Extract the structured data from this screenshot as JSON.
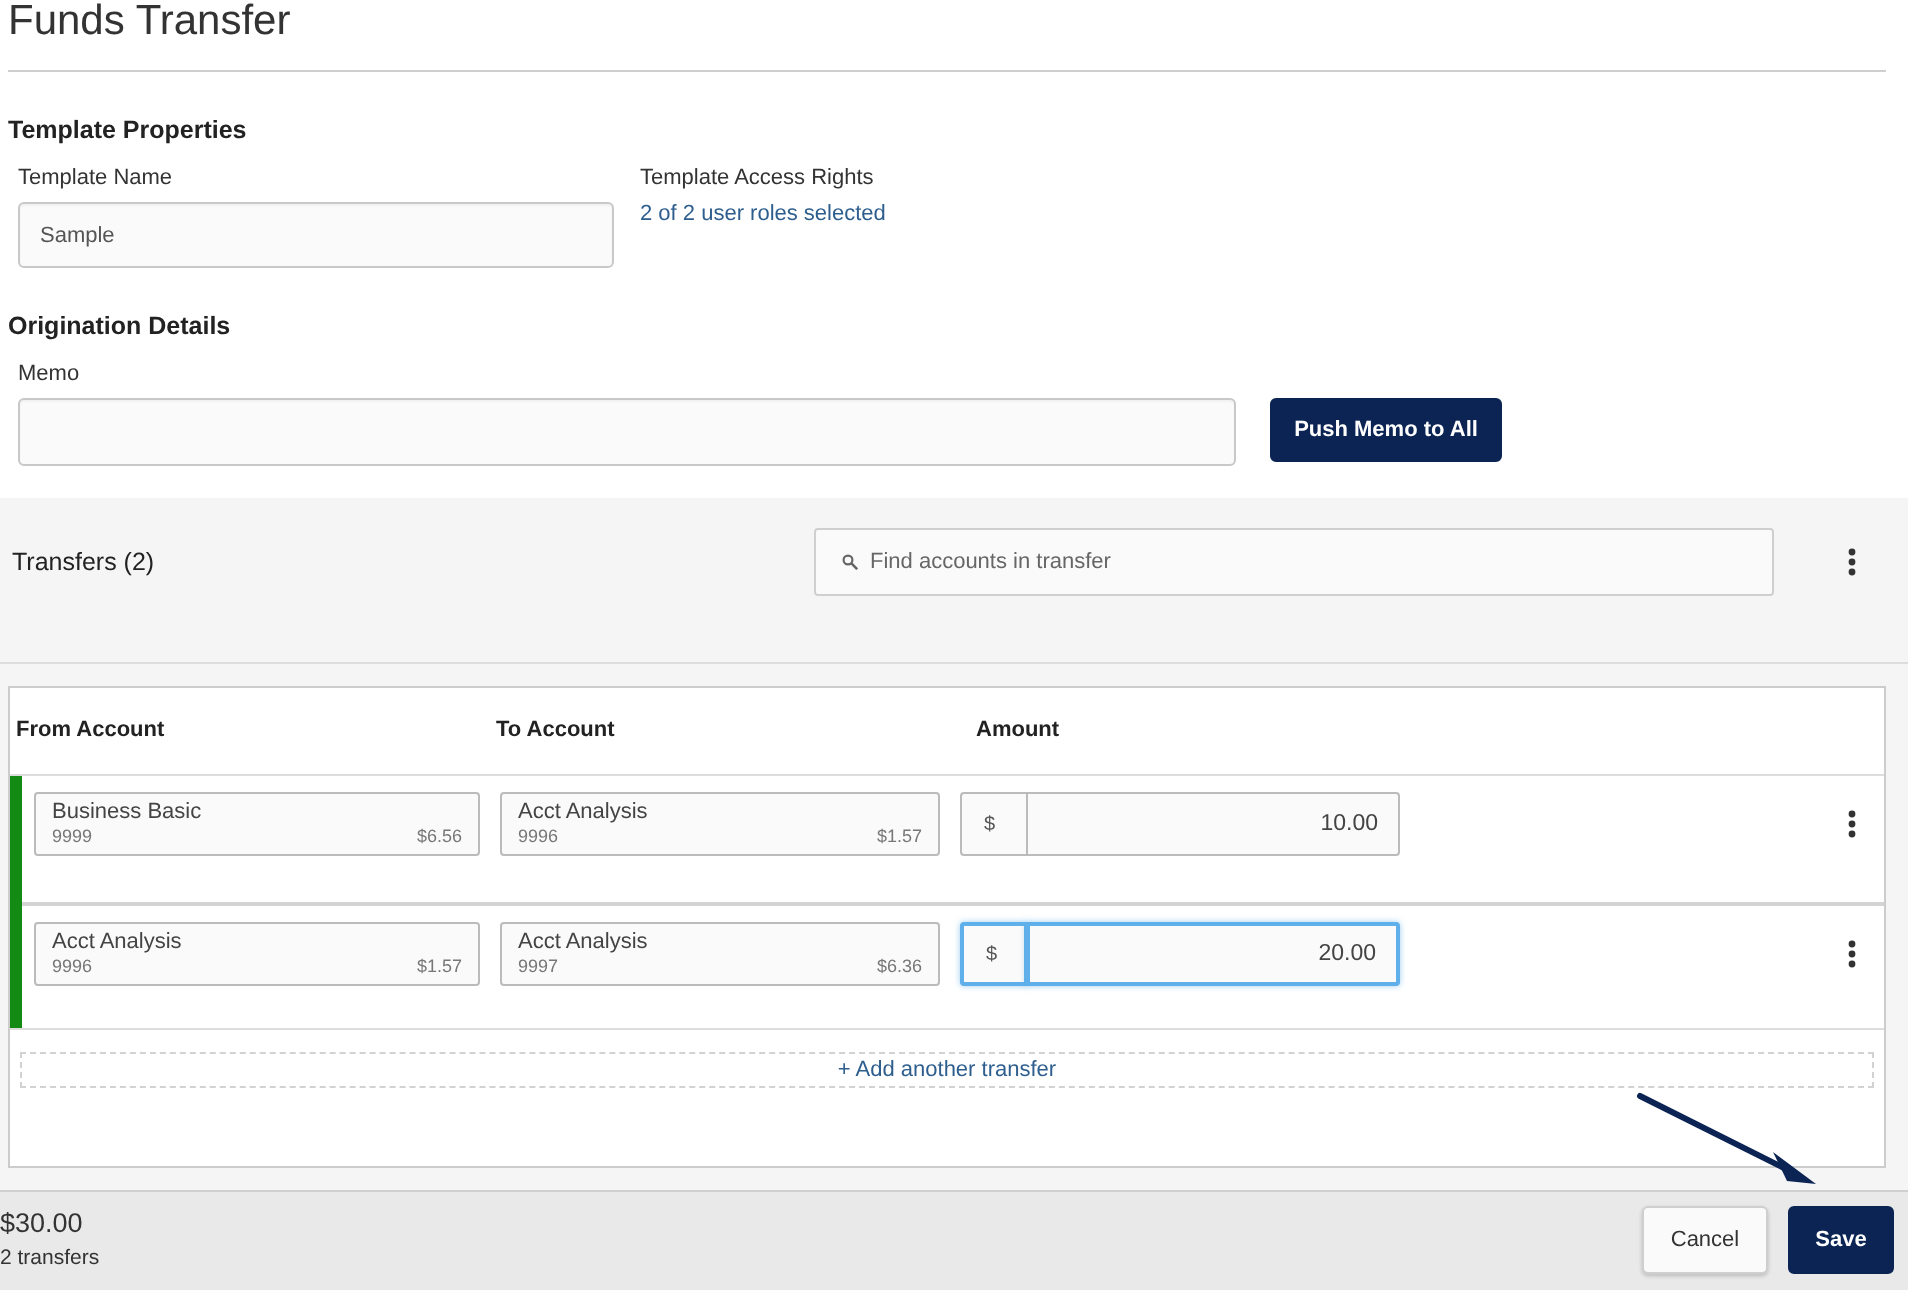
{
  "page": {
    "title": "Funds Transfer"
  },
  "template_properties": {
    "heading": "Template Properties",
    "name_label": "Template Name",
    "name_value": "Sample",
    "access_label": "Template Access Rights",
    "access_link": "2 of 2 user roles selected"
  },
  "origination_details": {
    "heading": "Origination Details",
    "memo_label": "Memo",
    "push_button": "Push Memo to All"
  },
  "transfers": {
    "heading": "Transfers (2)",
    "search": {
      "placeholder": "Find accounts in transfer"
    },
    "columns": [
      "From Account",
      "To Account",
      "Amount"
    ],
    "rows": [
      {
        "from": {
          "name": "Business Basic",
          "number": "9999",
          "balance": "$6.56"
        },
        "to": {
          "name": "Acct Analysis",
          "number": "9996",
          "balance": "$1.57"
        },
        "currency": "$",
        "amount": "10.00",
        "focused": false
      },
      {
        "from": {
          "name": "Acct Analysis",
          "number": "9996",
          "balance": "$1.57"
        },
        "to": {
          "name": "Acct Analysis",
          "number": "9997",
          "balance": "$6.36"
        },
        "currency": "$",
        "amount": "20.00",
        "focused": true
      }
    ],
    "add_link": "+ Add another transfer"
  },
  "footer": {
    "total": "$30.00",
    "count": "2 transfers",
    "buttons": [
      {
        "label": "Cancel",
        "kind": "cancel"
      },
      {
        "label": "Save",
        "kind": "save"
      }
    ]
  }
}
